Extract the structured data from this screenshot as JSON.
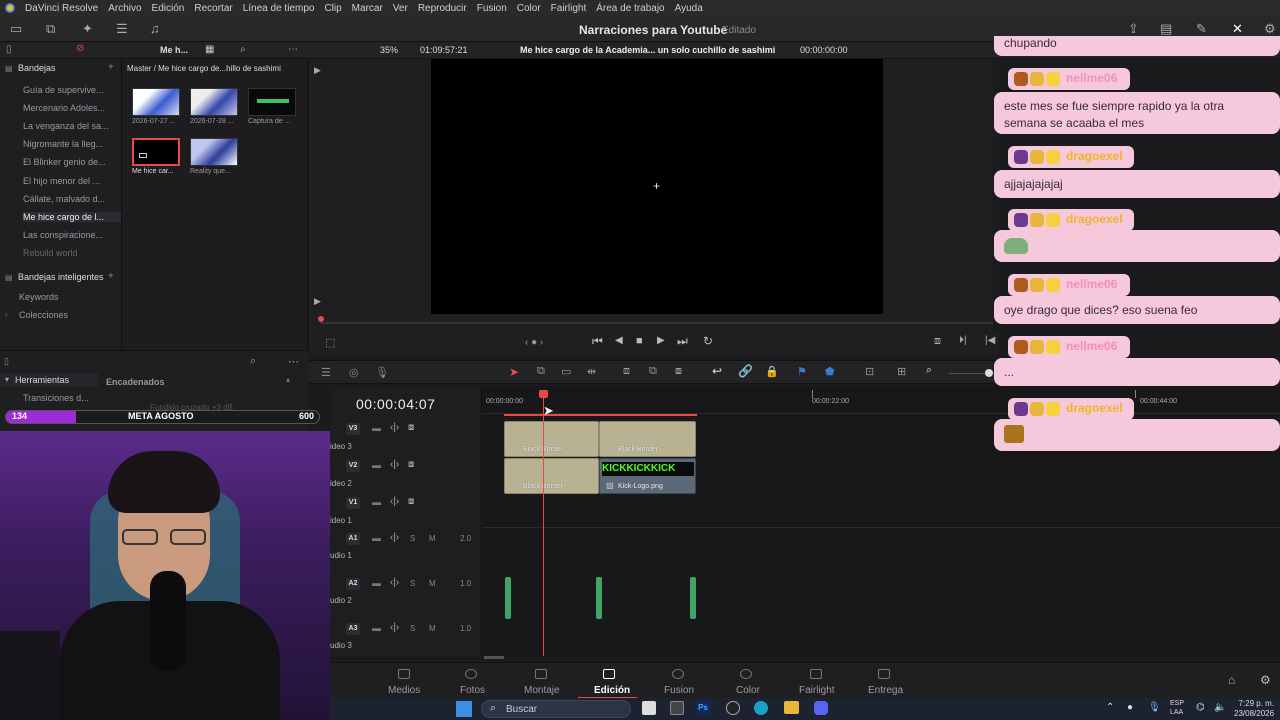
{
  "menu": [
    "DaVinci Resolve",
    "Archivo",
    "Edición",
    "Recortar",
    "Línea de tiempo",
    "Clip",
    "Marcar",
    "Ver",
    "Reproducir",
    "Fusion",
    "Color",
    "Fairlight",
    "Área de trabajo",
    "Ayuda"
  ],
  "project": {
    "title": "Narraciones para Youtube",
    "status": "Editado"
  },
  "toolbar": {
    "bin_short": "Me h...",
    "zoom": "35%",
    "timecode": "01:09:57:21",
    "clip_name": "Me hice cargo de la Academia... un solo cuchillo de sashimi",
    "viewer_timecode": "00:00:00:00"
  },
  "bins": {
    "header": "Bandejas",
    "items": [
      "Guía de supervive...",
      "Mercenario Adoles...",
      "La venganza del sa...",
      "Nigromante la lleg...",
      "El Blinker genio de...",
      "El hijo menor del ...",
      "Cállate, malvado d...",
      "Me hice cargo de l...",
      "Las conspiracione...",
      "Rebuild world"
    ],
    "smart_header": "Bandejas inteligentes",
    "smart_items": [
      "Keywords",
      "Colecciones"
    ]
  },
  "mediapool": {
    "path": "Master / Me hice cargo de...hillo de sashimi",
    "clips": [
      {
        "label": "2026-07-27 ..."
      },
      {
        "label": "2026-07-28 ..."
      },
      {
        "label": "Captura de ..."
      },
      {
        "label": "Me hice car..."
      },
      {
        "label": "Reality que..."
      }
    ]
  },
  "effects": {
    "tools": "Herramientas",
    "transitions": "Transiciones d...",
    "header": "Encadenados",
    "item1": "Fundido cruzado +3 dB"
  },
  "goal": {
    "current": "134",
    "label": "META AGOSTO",
    "target": "600",
    "progress": 0.223
  },
  "timeline": {
    "timecode": "00:00:04:07",
    "ruler": [
      "00:00:00:00",
      "00:00:22:00",
      "00:00:44:00"
    ],
    "tracks": [
      {
        "id": "V3",
        "name": "ideo 3"
      },
      {
        "id": "V2",
        "name": "ideo 2"
      },
      {
        "id": "V1",
        "name": "ideo 1"
      },
      {
        "id": "A1",
        "name": "udio 1",
        "level": "2.0"
      },
      {
        "id": "A2",
        "name": "udio 2",
        "level": "1.0"
      },
      {
        "id": "A3",
        "name": "udio 3",
        "level": "1.0"
      }
    ],
    "clips": [
      "Black Border",
      "Black Border",
      "Black Border",
      "Kick-Logo.png"
    ],
    "kick_text": "KICKKICKKICK"
  },
  "pages": [
    "Medios",
    "Fotos",
    "Montaje",
    "Edición",
    "Fusion",
    "Color",
    "Fairlight",
    "Entrega"
  ],
  "taskbar": {
    "search": "Buscar",
    "lang1": "ESP",
    "lang2": "LAA",
    "time": "7:29 p. m.",
    "date": "23/08/2026"
  },
  "chat": [
    {
      "user": "",
      "text": "chupando"
    },
    {
      "user": "nellme06",
      "text": "este mes se fue siempre rapido ya la otra semana se acaaba el mes"
    },
    {
      "user": "dragoexel",
      "text": "ajjajajajajaj"
    },
    {
      "user": "dragoexel",
      "text": ""
    },
    {
      "user": "nellme06",
      "text": "oye drago que dices? eso suena feo"
    },
    {
      "user": "nellme06",
      "text": "..."
    },
    {
      "user": "dragoexel",
      "text": ""
    }
  ],
  "colors": {
    "accent": "#e54b4b",
    "chat_bg": "#f6c8db",
    "nell": "#f290b8",
    "drago": "#f0b429",
    "audio": "#3fa465",
    "goal": "#9d2cd7"
  }
}
